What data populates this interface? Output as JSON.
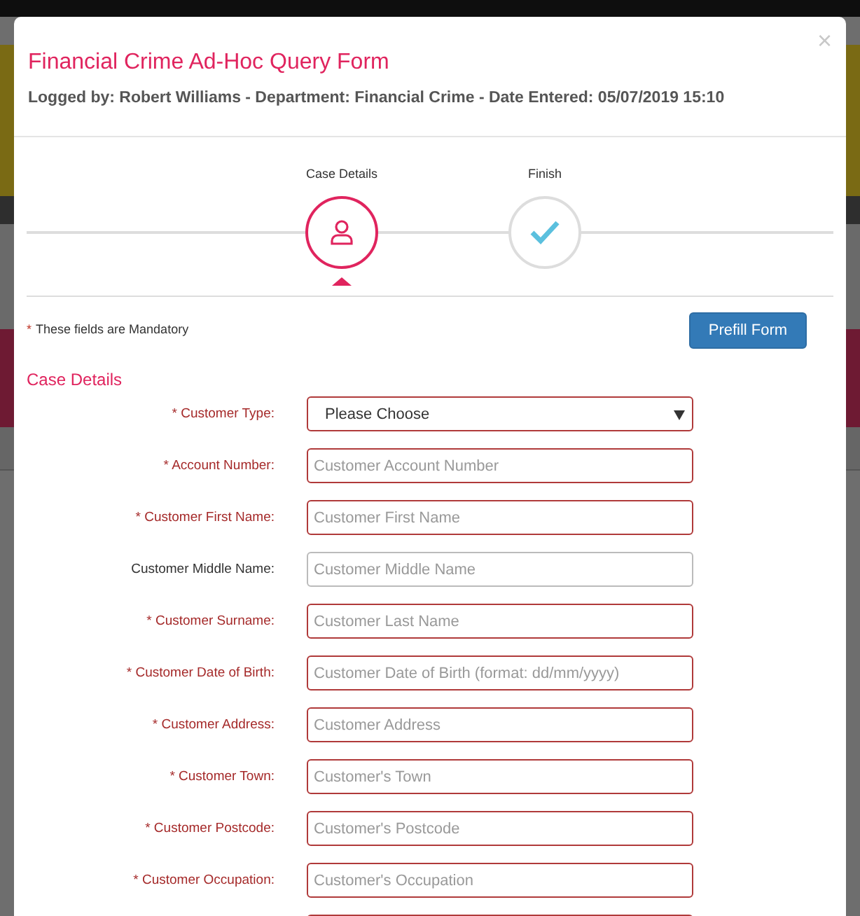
{
  "modal": {
    "title": "Financial Crime Ad-Hoc Query Form",
    "subtitle": "Logged by: Robert Williams - Department: Financial Crime - Date Entered: 05/07/2019 15:10",
    "close": "×"
  },
  "steps": [
    {
      "label": "Case Details",
      "kind": "person",
      "selected": true
    },
    {
      "label": "Finish",
      "kind": "check",
      "selected": false
    }
  ],
  "mandatory_note": {
    "marker": "*",
    "text": "These fields are Mandatory"
  },
  "prefill_button": "Prefill Form",
  "section_title": "Case Details",
  "fields": [
    {
      "kind": "select",
      "label": "* Customer Type:",
      "required": true,
      "value": "Please Choose"
    },
    {
      "kind": "text",
      "label": "* Account Number:",
      "required": true,
      "placeholder": "Customer Account Number"
    },
    {
      "kind": "text",
      "label": "* Customer First Name:",
      "required": true,
      "placeholder": "Customer First Name"
    },
    {
      "kind": "text",
      "label": "Customer Middle Name:",
      "required": false,
      "placeholder": "Customer Middle Name"
    },
    {
      "kind": "text",
      "label": "* Customer Surname:",
      "required": true,
      "placeholder": "Customer Last Name"
    },
    {
      "kind": "text",
      "label": "* Customer Date of Birth:",
      "required": true,
      "placeholder": "Customer Date of Birth (format: dd/mm/yyyy)"
    },
    {
      "kind": "text",
      "label": "* Customer Address:",
      "required": true,
      "placeholder": "Customer Address"
    },
    {
      "kind": "text",
      "label": "* Customer Town:",
      "required": true,
      "placeholder": "Customer's Town"
    },
    {
      "kind": "text",
      "label": "* Customer Postcode:",
      "required": true,
      "placeholder": "Customer's Postcode"
    },
    {
      "kind": "text",
      "label": "* Customer Occupation:",
      "required": true,
      "placeholder": "Customer's Occupation"
    },
    {
      "kind": "text",
      "required": true
    }
  ]
}
